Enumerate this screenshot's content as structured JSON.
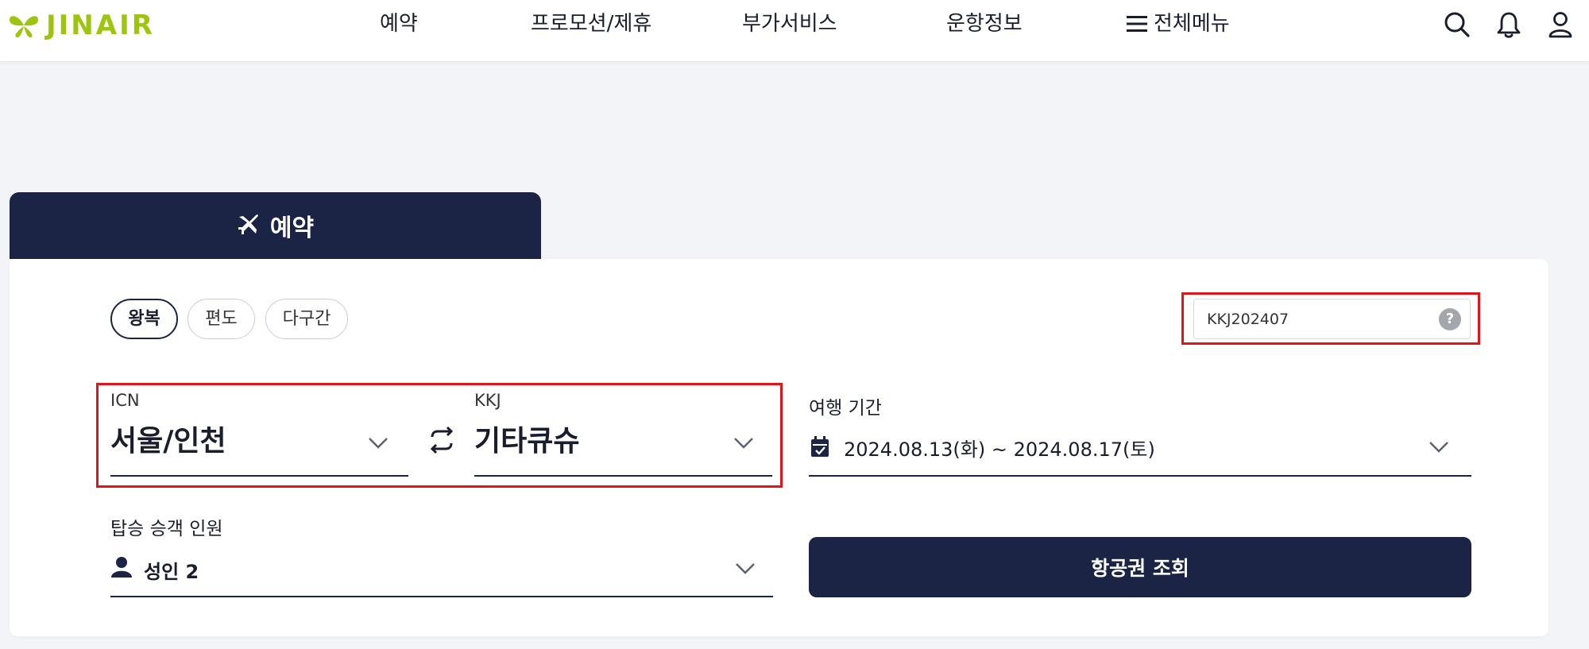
{
  "header": {
    "logo_text": "JINAIR",
    "nav": [
      "예약",
      "프로모션/제휴",
      "부가서비스",
      "운항정보"
    ],
    "menu_label": "전체메뉴",
    "brand_color": "#9dc50f"
  },
  "booking": {
    "tab_label": "예약",
    "trip_types": [
      "왕복",
      "편도",
      "다구간"
    ],
    "selected_trip_type": "왕복",
    "promo_code": "KKJ202407",
    "help_symbol": "?",
    "origin": {
      "code": "ICN",
      "city": "서울/인천"
    },
    "destination": {
      "code": "KKJ",
      "city": "기타큐슈"
    },
    "travel_period_label": "여행 기간",
    "travel_period_value": "2024.08.13(화) ~ 2024.08.17(토)",
    "passenger_label": "탑승 승객 인원",
    "passenger_value": "성인 2",
    "search_button": "항공권 조회"
  },
  "colors": {
    "navy": "#1b2444",
    "highlight": "#e3131a"
  }
}
